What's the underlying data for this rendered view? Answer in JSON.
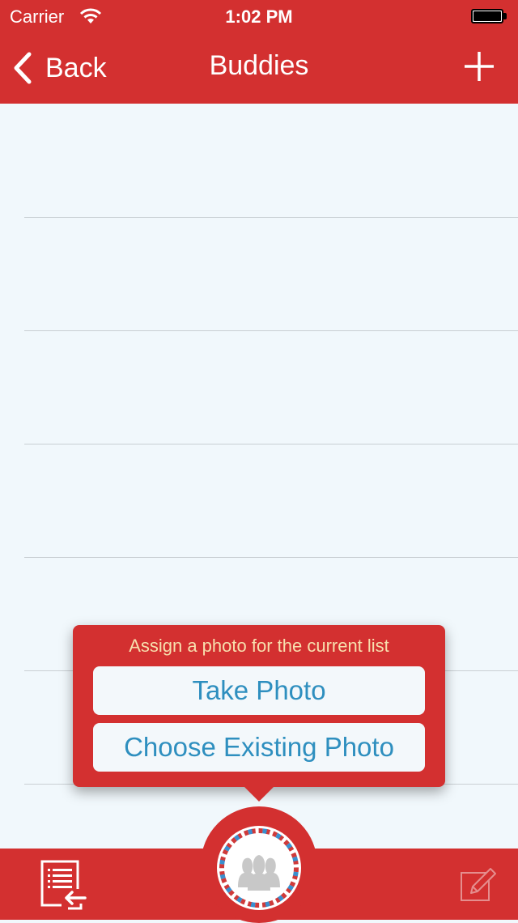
{
  "status_bar": {
    "carrier": "Carrier",
    "time": "1:02 PM",
    "icons": [
      "wifi-icon",
      "battery-icon"
    ]
  },
  "nav_bar": {
    "back_label": "Back",
    "title": "Buddies",
    "add_icon": "plus-icon"
  },
  "popover": {
    "title": "Assign a photo for the current list",
    "take_photo_label": "Take Photo",
    "choose_photo_label": "Choose Existing Photo"
  },
  "tab_bar": {
    "icons": [
      "list-import-icon",
      "group-avatar-icon",
      "edit-icon"
    ]
  },
  "colors": {
    "primary": "#d33030",
    "background": "#f1f8fc",
    "popover_title": "#f7dfae",
    "button_text": "#2e8fbf",
    "divider": "#c9cfd3"
  }
}
